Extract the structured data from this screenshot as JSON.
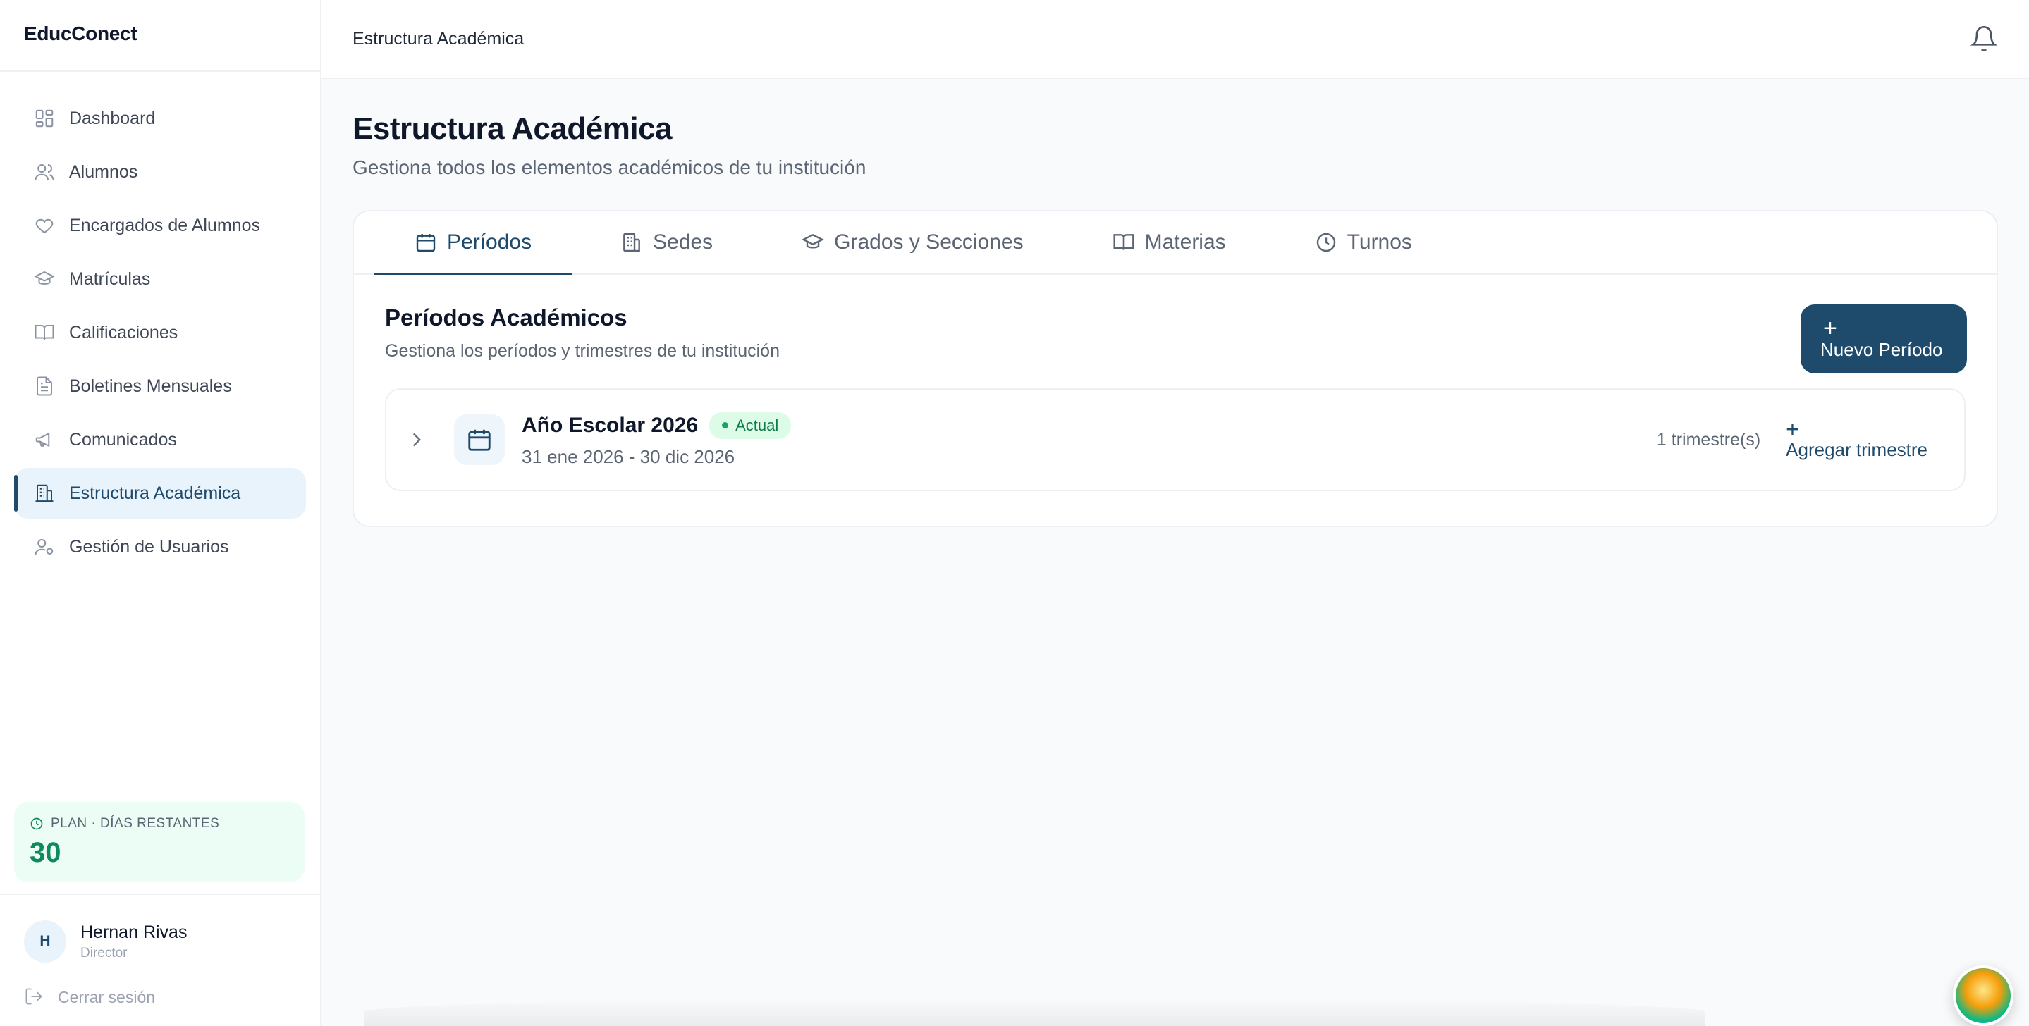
{
  "app": {
    "brand": "EducConect"
  },
  "sidebar": {
    "items": [
      {
        "label": "Dashboard",
        "icon": "dashboard-grid-icon"
      },
      {
        "label": "Alumnos",
        "icon": "users-icon"
      },
      {
        "label": "Encargados de Alumnos",
        "icon": "heart-icon"
      },
      {
        "label": "Matrículas",
        "icon": "graduation-cap-icon"
      },
      {
        "label": "Calificaciones",
        "icon": "book-open-icon"
      },
      {
        "label": "Boletines Mensuales",
        "icon": "file-text-icon"
      },
      {
        "label": "Comunicados",
        "icon": "megaphone-icon"
      },
      {
        "label": "Estructura Académica",
        "icon": "building-icon",
        "active": true
      },
      {
        "label": "Gestión de Usuarios",
        "icon": "user-cog-icon"
      }
    ],
    "plan": {
      "label": "PLAN · DÍAS RESTANTES",
      "value": "30"
    },
    "user": {
      "initial": "H",
      "name": "Hernan Rivas",
      "role": "Director"
    },
    "logout_label": "Cerrar sesión"
  },
  "topbar": {
    "title": "Estructura Académica"
  },
  "page": {
    "title": "Estructura Académica",
    "subtitle": "Gestiona todos los elementos académicos de tu institución"
  },
  "tabs": [
    {
      "label": "Períodos",
      "icon": "calendar-icon",
      "active": true
    },
    {
      "label": "Sedes",
      "icon": "building-icon"
    },
    {
      "label": "Grados y Secciones",
      "icon": "graduation-cap-icon"
    },
    {
      "label": "Materias",
      "icon": "book-open-icon"
    },
    {
      "label": "Turnos",
      "icon": "clock-icon"
    }
  ],
  "section": {
    "title": "Períodos Académicos",
    "subtitle": "Gestiona los períodos y trimestres de tu institución",
    "new_button": {
      "plus": "+",
      "label": "Nuevo Período"
    }
  },
  "periods": [
    {
      "name": "Año Escolar 2026",
      "badge": "Actual",
      "dates": "31 ene 2026 - 30 dic 2026",
      "count": "1 trimestre(s)",
      "add_plus": "+",
      "add_label": "Agregar trimestre"
    }
  ],
  "colors": {
    "primary": "#1e4a6b",
    "active_bg": "#e8f3fb",
    "plan_bg": "#ecfdf5",
    "plan_value": "#0f8a60",
    "badge_bg": "#dcfce7"
  }
}
